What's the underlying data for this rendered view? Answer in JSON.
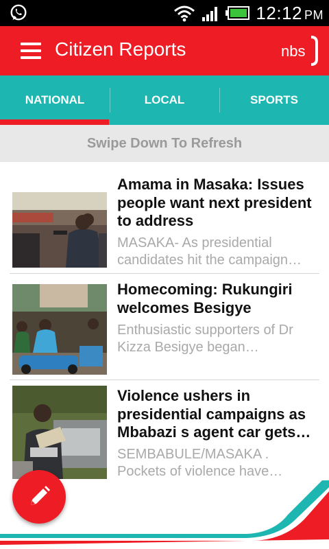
{
  "status_bar": {
    "time": "12:12",
    "ampm": "PM",
    "icons": [
      "whatsapp-icon",
      "wifi-icon",
      "signal-icon",
      "battery-icon"
    ]
  },
  "app_bar": {
    "title": "Citizen Reports",
    "logo_text": "nbs",
    "brand_color": "#ee1c24"
  },
  "tabs": [
    {
      "label": "NATIONAL",
      "active": true
    },
    {
      "label": "LOCAL",
      "active": false
    },
    {
      "label": "SPORTS",
      "active": false
    }
  ],
  "tab_bar_color": "#1eb6b1",
  "refresh_hint": "Swipe Down To Refresh",
  "articles": [
    {
      "title_lines": [
        "Amama in Masaka: Issues",
        "people want next president",
        "to address"
      ],
      "snippet_lines": [
        "MASAKA- As presidential",
        "candidates hit the campaign…"
      ]
    },
    {
      "title_lines": [
        "Homecoming: Rukungiri",
        "welcomes Besigye"
      ],
      "snippet_lines": [
        "Enthusiastic supporters of Dr",
        "Kizza Besigye began…"
      ]
    },
    {
      "title_lines": [
        "Violence ushers in",
        "presidential campaigns as",
        "Mbabazi s agent car gets…"
      ],
      "snippet_lines": [
        "SEMBABULE/MASAKA .",
        "Pockets of violence have…"
      ]
    }
  ],
  "fab_icon": "pencil-icon"
}
